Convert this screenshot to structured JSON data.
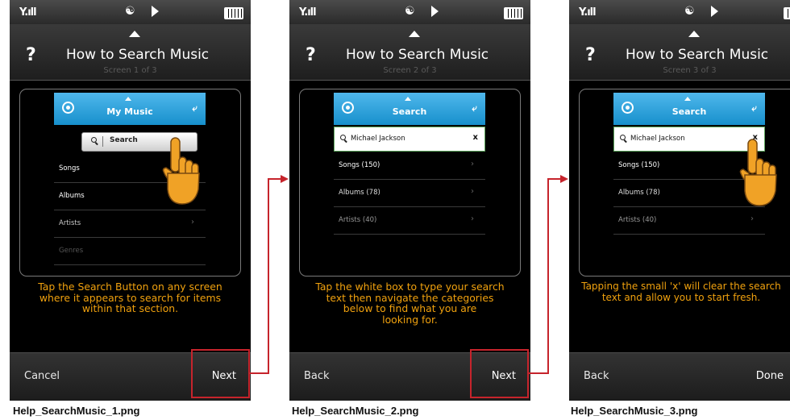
{
  "status_icons": [
    "signal-icon",
    "people-icon",
    "play-icon",
    "battery-icon"
  ],
  "status_signal": "Y.ıll",
  "accent_colors": {
    "header_blue": "#1e96d2",
    "instruction_orange": "#f0a10e",
    "highlight_red": "#c6242c"
  },
  "screens": [
    {
      "help_icon": "?",
      "title": "How to Search Music",
      "subtitle": "Screen 1 of 3",
      "inner_header": "My Music",
      "search_button": "Search",
      "rows": [
        {
          "label": "Songs",
          "chevron": "›"
        },
        {
          "label": "Albums",
          "chevron": "›"
        },
        {
          "label": "Artists",
          "chevron": "›"
        },
        {
          "label": "Genres",
          "chevron": ""
        }
      ],
      "instruction": "Tap the Search Button on any screen\nwhere it appears to search for items\nwithin that section.",
      "left_button": "Cancel",
      "right_button": "Next",
      "caption": "Help_SearchMusic_1.png"
    },
    {
      "help_icon": "?",
      "title": "How to Search Music",
      "subtitle": "Screen 2 of 3",
      "inner_header": "Search",
      "search_value": "Michael Jackson",
      "clear": "x",
      "rows": [
        {
          "label": "Songs (150)",
          "chevron": "›"
        },
        {
          "label": "Albums (78)",
          "chevron": "›"
        },
        {
          "label": "Artists (40)",
          "chevron": "›"
        }
      ],
      "instruction": "Tap the white box to type your search\ntext then navigate the categories\nbelow to find what you are\nlooking for.",
      "left_button": "Back",
      "right_button": "Next",
      "caption": "Help_SearchMusic_2.png"
    },
    {
      "help_icon": "?",
      "title": "How to Search Music",
      "subtitle": "Screen 3 of 3",
      "inner_header": "Search",
      "search_value": "Michael Jackson",
      "clear": "x",
      "rows": [
        {
          "label": "Songs (150)",
          "chevron": "›"
        },
        {
          "label": "Albums (78)",
          "chevron": "›"
        },
        {
          "label": "Artists (40)",
          "chevron": "›"
        }
      ],
      "instruction": "Tapping the small 'x' will clear the search\ntext and allow you to start fresh.",
      "left_button": "Back",
      "right_button": "Done",
      "caption": "Help_SearchMusic_3.png"
    }
  ]
}
